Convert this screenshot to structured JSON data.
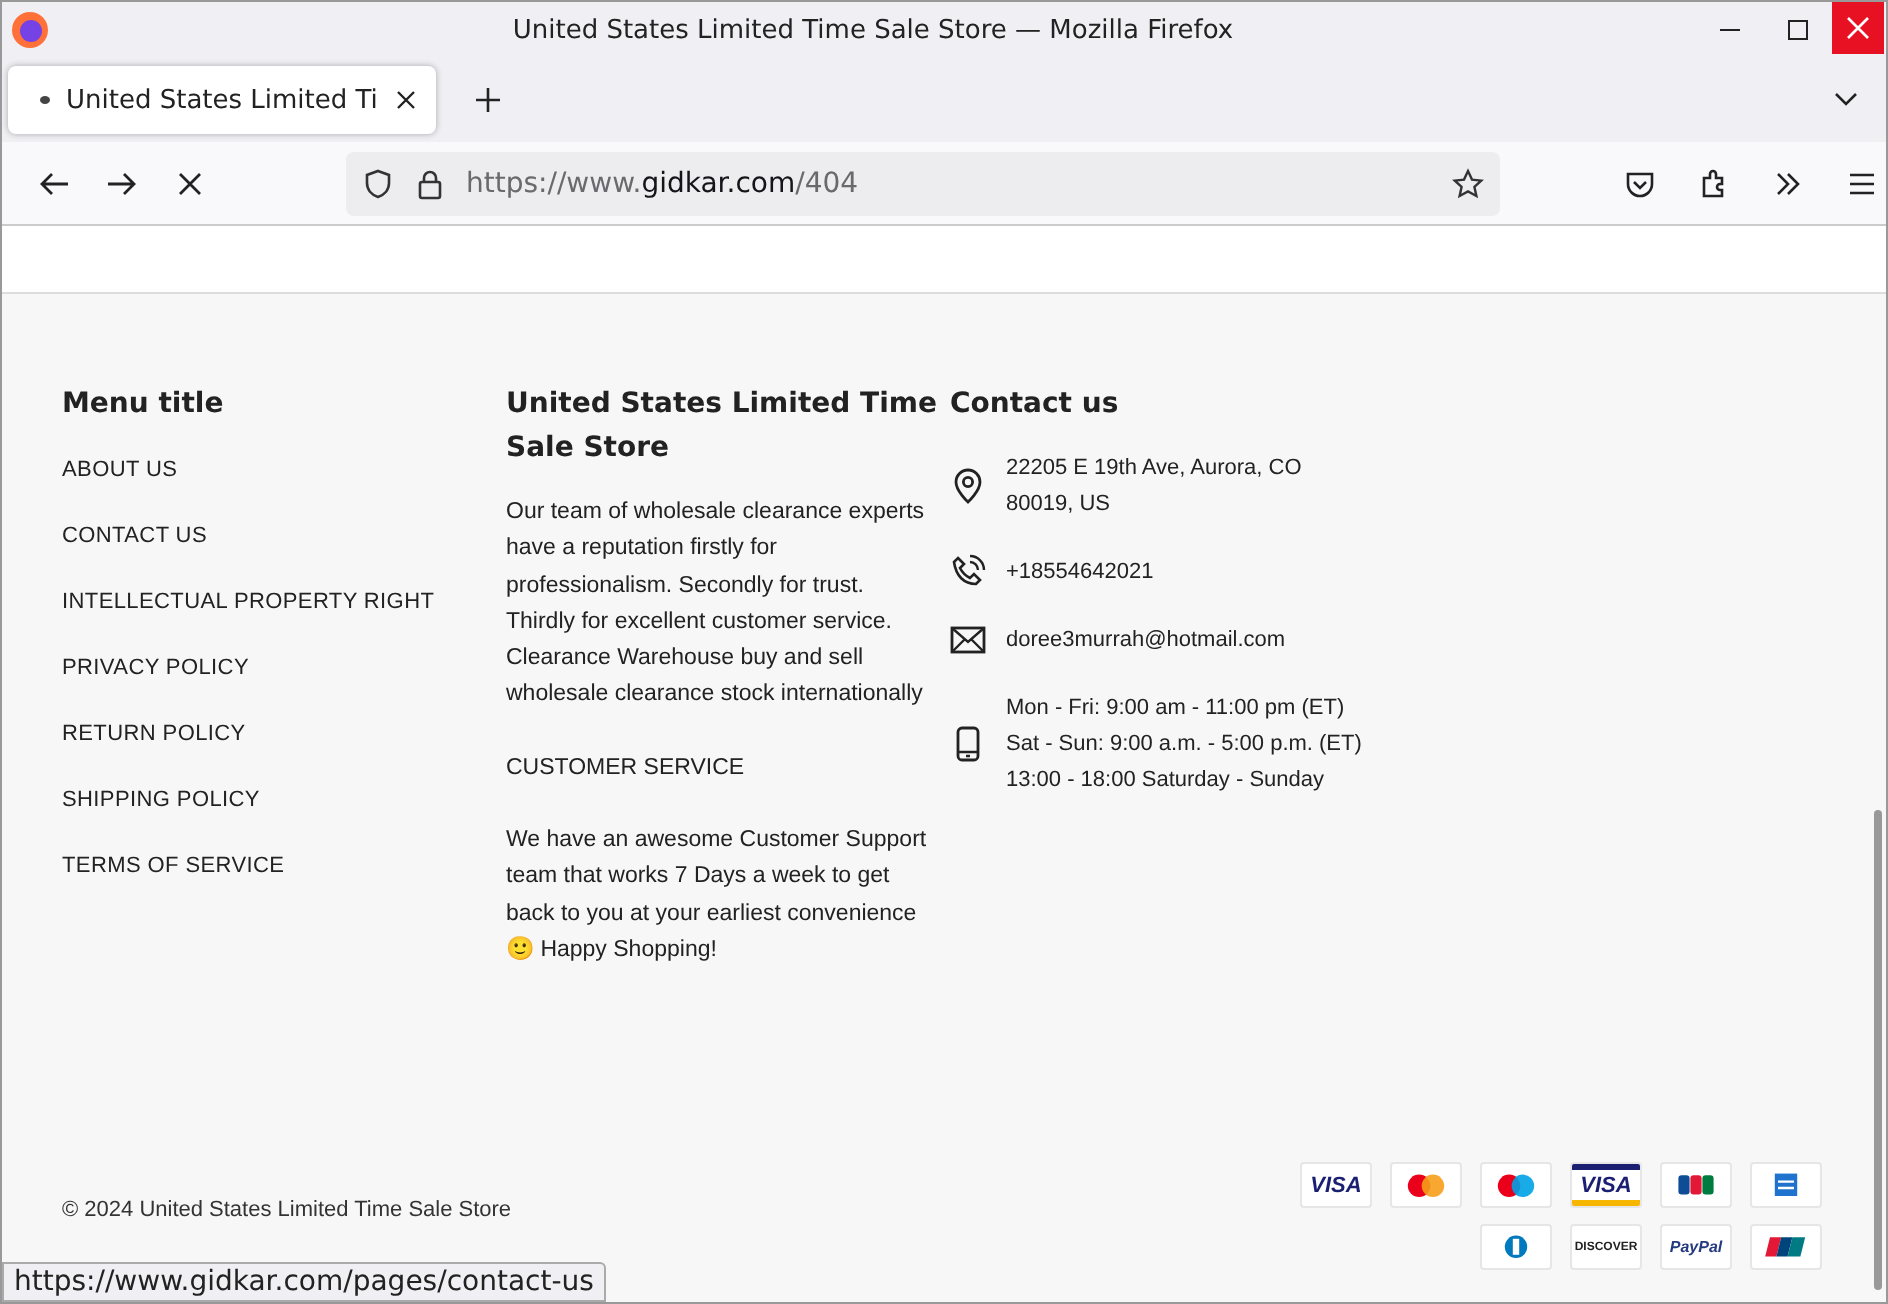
{
  "window": {
    "title": "United States Limited Time Sale Store — Mozilla Firefox"
  },
  "tabs": [
    {
      "label": "United States Limited Ti",
      "selected": true,
      "loading": true
    }
  ],
  "address_bar": {
    "scheme": "https://www.",
    "domain": "gidkar.com",
    "path": "/404"
  },
  "footer": {
    "menu": {
      "title": "Menu title",
      "items": [
        "ABOUT US",
        "CONTACT US",
        "INTELLECTUAL PROPERTY RIGHT",
        "PRIVACY POLICY",
        "RETURN POLICY",
        "SHIPPING POLICY",
        "TERMS OF SERVICE"
      ]
    },
    "about": {
      "title": "United States Limited Time Sale Store",
      "paragraphs": [
        "Our team of wholesale clearance experts have a reputation firstly for professionalism. Secondly for trust. Thirdly for excellent customer service. Clearance Warehouse buy and sell wholesale clearance stock internationally",
        "CUSTOMER SERVICE",
        "We have an awesome Customer Support team that works 7 Days a week to get back to you at your earliest convenience",
        "🙂 Happy Shopping!"
      ]
    },
    "contact": {
      "title": "Contact us",
      "items": [
        {
          "kind": "location",
          "lines": [
            "22205 E 19th Ave, Aurora, CO",
            "80019, US"
          ]
        },
        {
          "kind": "phone",
          "lines": [
            "+18554642021"
          ]
        },
        {
          "kind": "email",
          "lines": [
            "doree3murrah@hotmail.com"
          ]
        },
        {
          "kind": "hours",
          "lines": [
            "Mon - Fri: 9:00 am - 11:00 pm (ET)",
            "Sat - Sun: 9:00 a.m. - 5:00 p.m. (ET)",
            "13:00 - 18:00 Saturday - Sunday"
          ]
        }
      ]
    },
    "copyright": "© 2024 United States Limited Time Sale Store",
    "payments": [
      [
        {
          "kind": "visa",
          "label": "VISA"
        },
        {
          "kind": "mastercard"
        },
        {
          "kind": "maestro"
        },
        {
          "kind": "visa-electron",
          "label": "VISA"
        },
        {
          "kind": "jcb"
        },
        {
          "kind": "amex"
        }
      ],
      [
        {
          "kind": "diners"
        },
        {
          "kind": "discover",
          "label": "DISCOVER"
        },
        {
          "kind": "paypal",
          "label": "PayPal"
        },
        {
          "kind": "unionpay"
        }
      ]
    ]
  },
  "status_bar": {
    "link": "https://www.gidkar.com/pages/contact-us"
  }
}
